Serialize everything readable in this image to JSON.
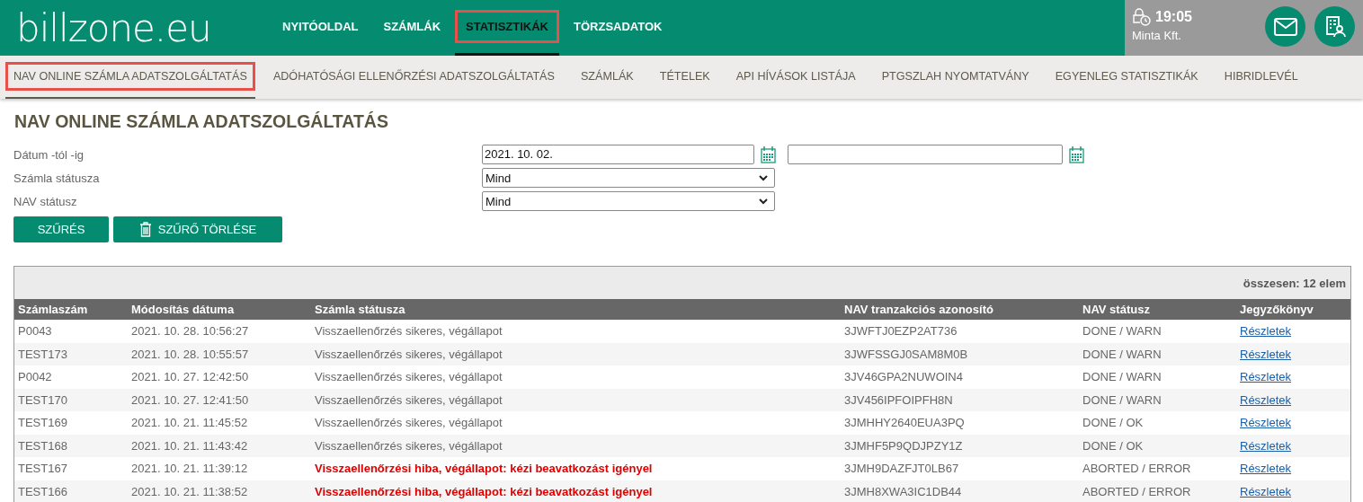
{
  "logo": "billzone.eu",
  "main_nav": [
    {
      "label": "NYITÓOLDAL",
      "selected": false
    },
    {
      "label": "SZÁMLÁK",
      "selected": false
    },
    {
      "label": "STATISZTIKÁK",
      "selected": true
    },
    {
      "label": "TÖRZSADATOK",
      "selected": false
    }
  ],
  "session": {
    "time": "19:05",
    "company": "Minta Kft."
  },
  "sub_nav": [
    {
      "label": "NAV ONLINE SZÁMLA ADATSZOLGÁLTATÁS",
      "selected": true
    },
    {
      "label": "ADÓHATÓSÁGI ELLENŐRZÉSI ADATSZOLGÁLTATÁS",
      "selected": false
    },
    {
      "label": "SZÁMLÁK",
      "selected": false
    },
    {
      "label": "TÉTELEK",
      "selected": false
    },
    {
      "label": "API HÍVÁSOK LISTÁJA",
      "selected": false
    },
    {
      "label": "PTGSZLAH NYOMTATVÁNY",
      "selected": false
    },
    {
      "label": "EGYENLEG STATISZTIKÁK",
      "selected": false
    },
    {
      "label": "HIBRIDLEVÉL",
      "selected": false
    }
  ],
  "page_title": "NAV ONLINE SZÁMLA ADATSZOLGÁLTATÁS",
  "filters": {
    "date_label": "Dátum -tól -ig",
    "date_from": "2021. 10. 02.",
    "status_label": "Számla státusza",
    "status_value": "Mind",
    "nav_label": "NAV státusz",
    "nav_value": "Mind"
  },
  "buttons": {
    "filter": "SZŰRÉS",
    "clear": "SZŰRŐ TÖRLÉSE"
  },
  "table": {
    "total": "összesen: 12 elem",
    "columns": [
      "Számlaszám",
      "Módosítás dátuma",
      "Számla státusza",
      "NAV tranzakciós azonosító",
      "NAV státusz",
      "Jegyzőkönyv"
    ],
    "rows": [
      {
        "number": "P0043",
        "date": "2021. 10. 28. 10:56:27",
        "status": "Visszaellenőrzés sikeres, végállapot",
        "error": false,
        "transaction_id": "3JWFTJ0EZP2AT736",
        "nav_status": "DONE / WARN",
        "link": "Részletek"
      },
      {
        "number": "TEST173",
        "date": "2021. 10. 28. 10:55:57",
        "status": "Visszaellenőrzés sikeres, végállapot",
        "error": false,
        "transaction_id": "3JWFSSGJ0SAM8M0B",
        "nav_status": "DONE / WARN",
        "link": "Részletek"
      },
      {
        "number": "P0042",
        "date": "2021. 10. 27. 12:42:50",
        "status": "Visszaellenőrzés sikeres, végállapot",
        "error": false,
        "transaction_id": "3JV46GPA2NUWOIN4",
        "nav_status": "DONE / WARN",
        "link": "Részletek"
      },
      {
        "number": "TEST170",
        "date": "2021. 10. 27. 12:41:50",
        "status": "Visszaellenőrzés sikeres, végállapot",
        "error": false,
        "transaction_id": "3JV456IPFOIPFH8N",
        "nav_status": "DONE / WARN",
        "link": "Részletek"
      },
      {
        "number": "TEST169",
        "date": "2021. 10. 21. 11:45:52",
        "status": "Visszaellenőrzés sikeres, végállapot",
        "error": false,
        "transaction_id": "3JMHHY2640EUA3PQ",
        "nav_status": "DONE / OK",
        "link": "Részletek"
      },
      {
        "number": "TEST168",
        "date": "2021. 10. 21. 11:43:42",
        "status": "Visszaellenőrzés sikeres, végállapot",
        "error": false,
        "transaction_id": "3JMHF5P9QDJPZY1Z",
        "nav_status": "DONE / OK",
        "link": "Részletek"
      },
      {
        "number": "TEST167",
        "date": "2021. 10. 21. 11:39:12",
        "status": "Visszaellenőrzési hiba, végállapot: kézi beavatkozást igényel",
        "error": true,
        "transaction_id": "3JMH9DAZFJT0LB67",
        "nav_status": "ABORTED / ERROR",
        "link": "Részletek"
      },
      {
        "number": "TEST166",
        "date": "2021. 10. 21. 11:38:52",
        "status": "Visszaellenőrzési hiba, végállapot: kézi beavatkozást igényel",
        "error": true,
        "transaction_id": "3JMH8XWA3IC1DB44",
        "nav_status": "ABORTED / ERROR",
        "link": "Részletek"
      }
    ]
  }
}
